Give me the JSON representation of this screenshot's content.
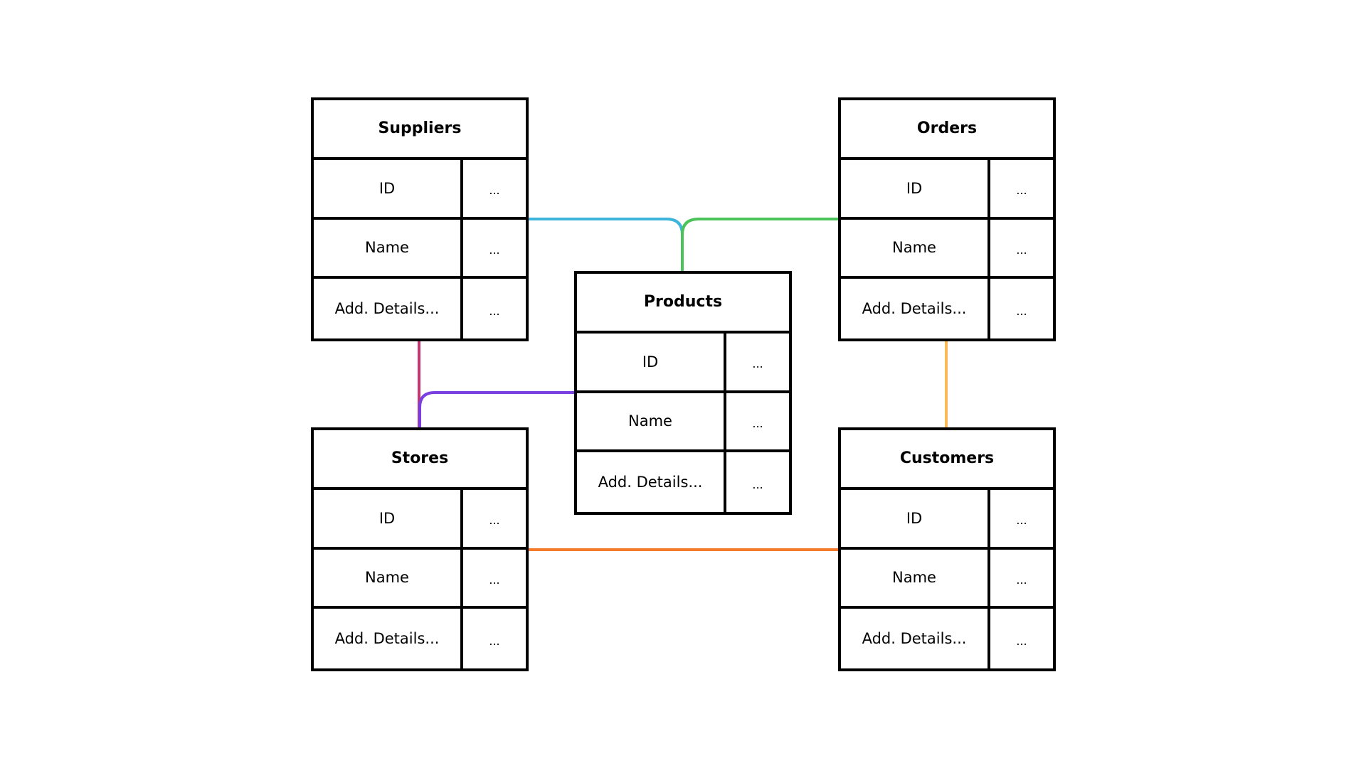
{
  "diagram": {
    "type": "entity-relationship",
    "entities": [
      {
        "id": "suppliers",
        "title": "Suppliers",
        "rows": [
          {
            "field": "ID",
            "value": "..."
          },
          {
            "field": "Name",
            "value": "..."
          },
          {
            "field": "Add. Details...",
            "value": "..."
          }
        ]
      },
      {
        "id": "orders",
        "title": "Orders",
        "rows": [
          {
            "field": "ID",
            "value": "..."
          },
          {
            "field": "Name",
            "value": "..."
          },
          {
            "field": "Add. Details...",
            "value": "..."
          }
        ]
      },
      {
        "id": "products",
        "title": "Products",
        "rows": [
          {
            "field": "ID",
            "value": "..."
          },
          {
            "field": "Name",
            "value": "..."
          },
          {
            "field": "Add. Details...",
            "value": "..."
          }
        ]
      },
      {
        "id": "stores",
        "title": "Stores",
        "rows": [
          {
            "field": "ID",
            "value": "..."
          },
          {
            "field": "Name",
            "value": "..."
          },
          {
            "field": "Add. Details...",
            "value": "..."
          }
        ]
      },
      {
        "id": "customers",
        "title": "Customers",
        "rows": [
          {
            "field": "ID",
            "value": "..."
          },
          {
            "field": "Name",
            "value": "..."
          },
          {
            "field": "Add. Details...",
            "value": "..."
          }
        ]
      }
    ],
    "links": [
      {
        "from": "suppliers",
        "to": "products",
        "color": "#3db4dc"
      },
      {
        "from": "orders",
        "to": "products",
        "color": "#4cc35a"
      },
      {
        "from": "suppliers",
        "to": "stores",
        "color": "#c8346e"
      },
      {
        "from": "products",
        "to": "stores",
        "color": "#7b3fe0"
      },
      {
        "from": "orders",
        "to": "customers",
        "color": "#f8bb55"
      },
      {
        "from": "stores",
        "to": "customers",
        "color": "#f57a2c"
      }
    ]
  }
}
